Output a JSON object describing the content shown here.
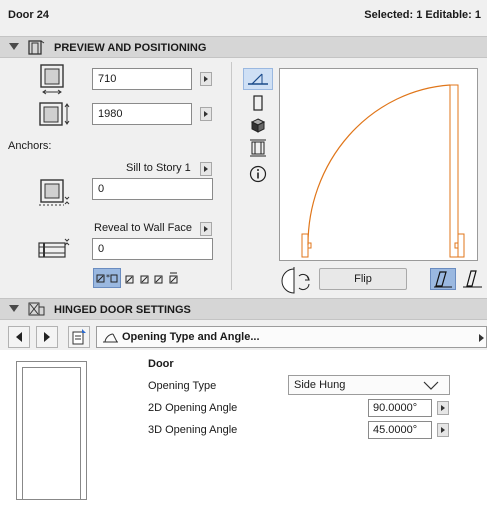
{
  "titlebar": {
    "title": "Door 24",
    "selection_info": "Selected: 1 Editable: 1"
  },
  "preview_section": {
    "header": "PREVIEW AND POSITIONING",
    "width_value": "710",
    "height_value": "1980",
    "anchors_label": "Anchors:",
    "sill_label": "Sill to Story 1",
    "sill_value": "0",
    "reveal_label": "Reveal to Wall Face",
    "reveal_value": "0",
    "flip_label": "Flip"
  },
  "hinged_section": {
    "header": "HINGED DOOR SETTINGS",
    "page_dropdown": "Opening Type and Angle...",
    "group_title": "Door",
    "rows": [
      {
        "label": "Opening Type",
        "value": "Side Hung"
      },
      {
        "label": "2D Opening Angle",
        "value": "90.0000°"
      },
      {
        "label": "3D Opening Angle",
        "value": "45.0000°"
      }
    ]
  },
  "colors": {
    "accent_blue": "#9ab8e0",
    "door_line": "#e0761a"
  },
  "icons": [
    "door-width-icon",
    "door-height-icon",
    "sill-anchor-icon",
    "reveal-anchor-icon",
    "plan-view-icon",
    "section-view-icon",
    "3d-view-icon",
    "elevation-view-icon",
    "info-icon",
    "mirror-icon",
    "flip-side-icon",
    "prev-icon",
    "next-icon",
    "page-list-icon"
  ]
}
